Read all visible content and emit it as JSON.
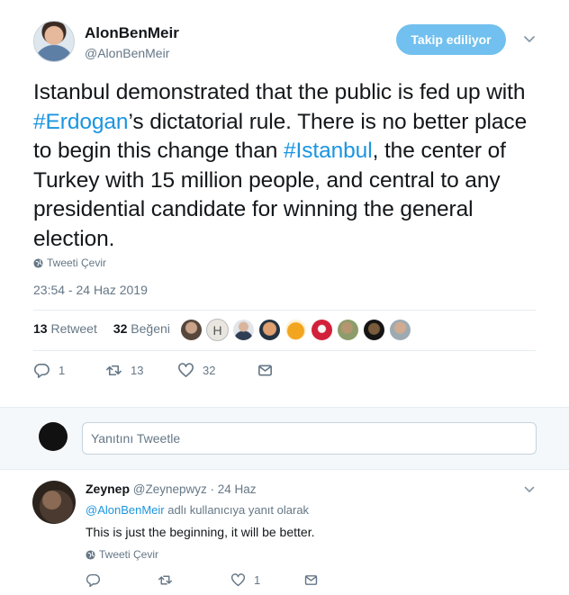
{
  "tweet": {
    "author_name": "AlonBenMeir",
    "author_handle": "@AlonBenMeir",
    "follow_label": "Takip ediliyor",
    "text_parts": {
      "p1": "Istanbul demonstrated that the public is fed up with ",
      "h1": "#Erdogan",
      "p2": "’s dictatorial rule. There is no better place to begin this change than ",
      "h2": "#Istanbul",
      "p3": ", the center of Turkey with 15 million people, and central to any presidential candidate for winning the general election."
    },
    "translate_label": "Tweeti Çevir",
    "timestamp": "23:54 - 24 Haz 2019",
    "retweet_count": "13",
    "retweet_label": "Retweet",
    "like_count": "32",
    "like_label": "Beğeni",
    "actions": {
      "reply_count": "1",
      "retweet_count": "13",
      "like_count": "32"
    }
  },
  "reply_box": {
    "placeholder": "Yanıtını Tweetle"
  },
  "reply": {
    "author_name": "Zeynep",
    "author_handle": "@Zeynepwyz",
    "date": "· 24 Haz",
    "replying_to_handle": "@AlonBenMeir",
    "replying_to_suffix": " adlı kullanıcıya yanıt olarak",
    "text": "This is just the beginning, it will be better.",
    "translate_label": "Tweeti Çevir",
    "actions": {
      "reply_count": "",
      "retweet_count": "",
      "like_count": "1"
    }
  },
  "colors": {
    "accent": "#1b95e0",
    "follow_button": "#71c0ef",
    "muted": "#657786",
    "text": "#14171a",
    "reply_bg": "#f5f8fa"
  },
  "liker_avatars": [
    "avatar-1",
    "avatar-2",
    "avatar-3",
    "avatar-4",
    "avatar-5",
    "avatar-6",
    "avatar-7",
    "avatar-8",
    "avatar-9"
  ]
}
